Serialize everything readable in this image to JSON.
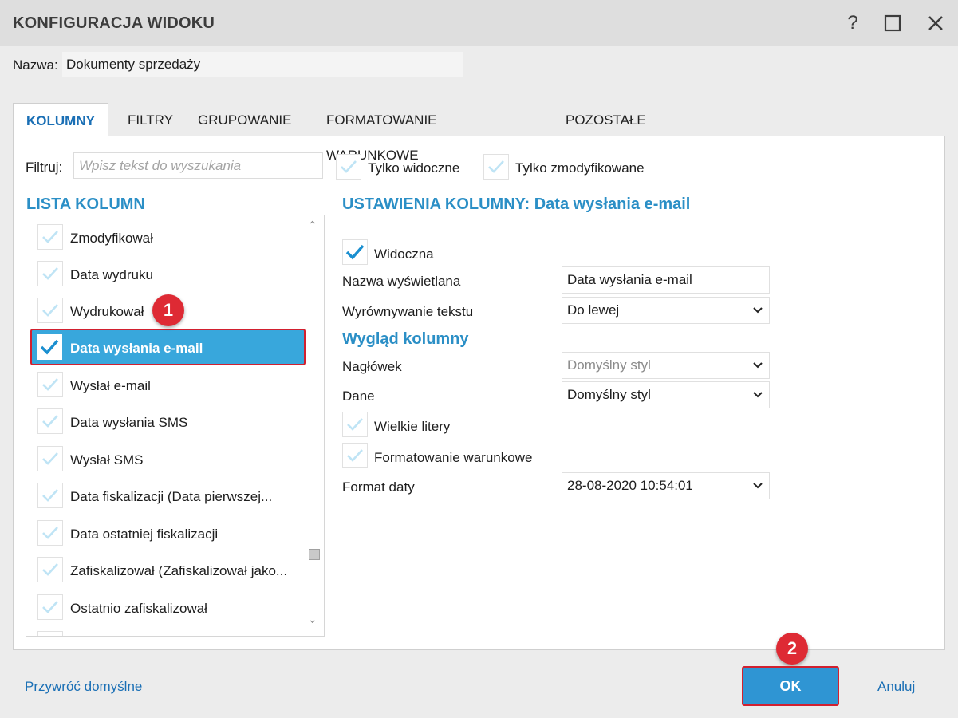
{
  "window": {
    "title": "KONFIGURACJA WIDOKU",
    "help_label": "?",
    "buttons": [
      "help-icon",
      "maximize-icon",
      "close-icon"
    ]
  },
  "name": {
    "label": "Nazwa:",
    "value": "Dokumenty sprzedaży"
  },
  "tabs": [
    {
      "label": "KOLUMNY",
      "active": true
    },
    {
      "label": "FILTRY"
    },
    {
      "label": "GRUPOWANIE"
    },
    {
      "label": "FORMATOWANIE WARUNKOWE"
    },
    {
      "label": "POZOSTAŁE"
    }
  ],
  "filter": {
    "label": "Filtruj:",
    "placeholder": "Wpisz tekst do wyszukania",
    "only_visible": "Tylko widoczne",
    "only_modified": "Tylko zmodyfikowane"
  },
  "column_list": {
    "title": "LISTA KOLUMN",
    "items": [
      {
        "label": "Zmodyfikował"
      },
      {
        "label": "Data wydruku"
      },
      {
        "label": "Wydrukował"
      },
      {
        "label": "Data wysłania e-mail",
        "selected": true
      },
      {
        "label": "Wysłał e-mail"
      },
      {
        "label": "Data wysłania SMS"
      },
      {
        "label": "Wysłał SMS"
      },
      {
        "label": "Data fiskalizacji (Data pierwszej..."
      },
      {
        "label": "Data ostatniej fiskalizacji"
      },
      {
        "label": "Zafiskalizował (Zafiskalizował jako..."
      },
      {
        "label": "Ostatnio zafiskalizował"
      }
    ]
  },
  "settings": {
    "title": "USTAWIENIA KOLUMNY: Data wysłania e-mail",
    "visible_label": "Widoczna",
    "display_name_label": "Nazwa wyświetlana",
    "display_name_value": "Data wysłania e-mail",
    "align_label": "Wyrównywanie tekstu",
    "align_value": "Do lewej",
    "appearance_title": "Wygląd kolumny",
    "header_label": "Nagłówek",
    "header_value": "Domyślny styl",
    "data_label": "Dane",
    "data_value": "Domyślny styl",
    "uppercase_label": "Wielkie litery",
    "conditional_label": "Formatowanie warunkowe",
    "date_format_label": "Format daty",
    "date_format_value": "28-08-2020 10:54:01"
  },
  "badges": {
    "one": "1",
    "two": "2"
  },
  "footer": {
    "restore": "Przywróć domyślne",
    "ok": "OK",
    "cancel": "Anuluj"
  },
  "colors": {
    "accent": "#2b8fc6",
    "selection": "#38a7dc",
    "highlight": "#d2202f",
    "link": "#1a6fb5"
  }
}
